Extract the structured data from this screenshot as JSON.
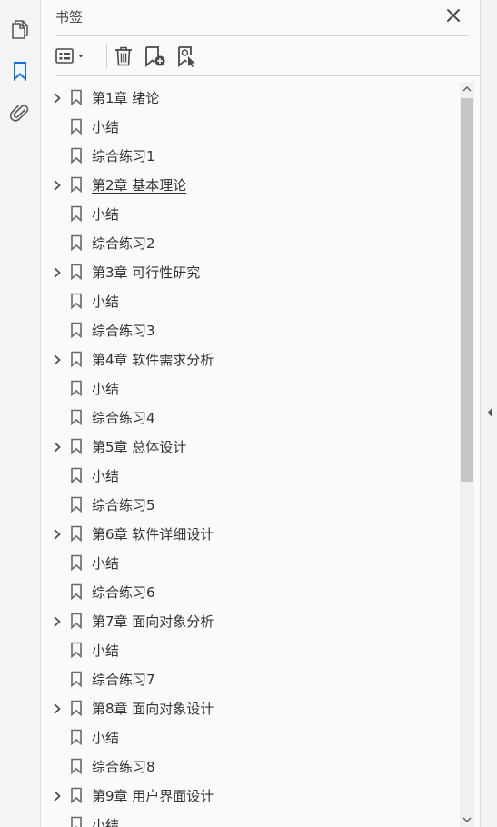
{
  "rail": {
    "icons": [
      "pages-icon",
      "bookmark-icon",
      "attachment-icon"
    ],
    "active": "bookmark-icon",
    "accent": "#1473e6"
  },
  "panel": {
    "title": "书签",
    "close_icon": "close-icon"
  },
  "toolbar": {
    "icons": [
      "options-menu-icon",
      "delete-icon",
      "new-bookmark-icon",
      "bookmark-from-selection-icon"
    ]
  },
  "bookmarks": [
    {
      "label": "第1章 绪论",
      "expandable": true,
      "underlined": false
    },
    {
      "label": "小结",
      "expandable": false,
      "underlined": false
    },
    {
      "label": "综合练习1",
      "expandable": false,
      "underlined": false
    },
    {
      "label": "第2章 基本理论",
      "expandable": true,
      "underlined": true
    },
    {
      "label": "小结",
      "expandable": false,
      "underlined": false
    },
    {
      "label": "综合练习2",
      "expandable": false,
      "underlined": false
    },
    {
      "label": "第3章 可行性研究",
      "expandable": true,
      "underlined": false
    },
    {
      "label": "小结",
      "expandable": false,
      "underlined": false
    },
    {
      "label": "综合练习3",
      "expandable": false,
      "underlined": false
    },
    {
      "label": "第4章 软件需求分析",
      "expandable": true,
      "underlined": false
    },
    {
      "label": "小结",
      "expandable": false,
      "underlined": false
    },
    {
      "label": "综合练习4",
      "expandable": false,
      "underlined": false
    },
    {
      "label": "第5章 总体设计",
      "expandable": true,
      "underlined": false
    },
    {
      "label": "小结",
      "expandable": false,
      "underlined": false
    },
    {
      "label": "综合练习5",
      "expandable": false,
      "underlined": false
    },
    {
      "label": "第6章 软件详细设计",
      "expandable": true,
      "underlined": false
    },
    {
      "label": "小结",
      "expandable": false,
      "underlined": false
    },
    {
      "label": "综合练习6",
      "expandable": false,
      "underlined": false
    },
    {
      "label": "第7章 面向对象分析",
      "expandable": true,
      "underlined": false
    },
    {
      "label": "小结",
      "expandable": false,
      "underlined": false
    },
    {
      "label": "综合练习7",
      "expandable": false,
      "underlined": false
    },
    {
      "label": "第8章 面向对象设计",
      "expandable": true,
      "underlined": false
    },
    {
      "label": "小结",
      "expandable": false,
      "underlined": false
    },
    {
      "label": "综合练习8",
      "expandable": false,
      "underlined": false
    },
    {
      "label": "第9章 用户界面设计",
      "expandable": true,
      "underlined": false
    },
    {
      "label": "小结",
      "expandable": false,
      "underlined": false
    }
  ]
}
